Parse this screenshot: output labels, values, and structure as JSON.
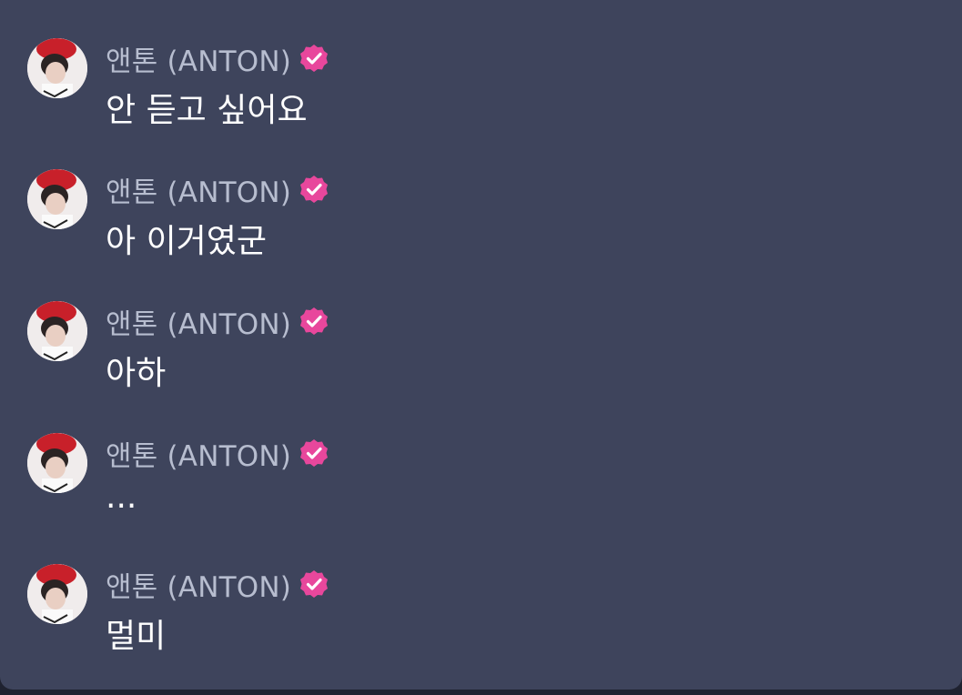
{
  "chat": {
    "messages": [
      {
        "author": "앤톤 (ANTON)",
        "text": "안 듣고 싶어요"
      },
      {
        "author": "앤톤 (ANTON)",
        "text": "아 이거였군"
      },
      {
        "author": "앤톤 (ANTON)",
        "text": "아하"
      },
      {
        "author": "앤톤 (ANTON)",
        "text": "..."
      },
      {
        "author": "앤톤 (ANTON)",
        "text": "멀미"
      }
    ]
  },
  "colors": {
    "background": "#3e445c",
    "name": "#b7bdcf",
    "message": "#ffffff",
    "verified_badge": "#e8479c"
  },
  "icons": {
    "avatar": "profile-photo-avatar",
    "badge": "verified-badge-icon"
  }
}
